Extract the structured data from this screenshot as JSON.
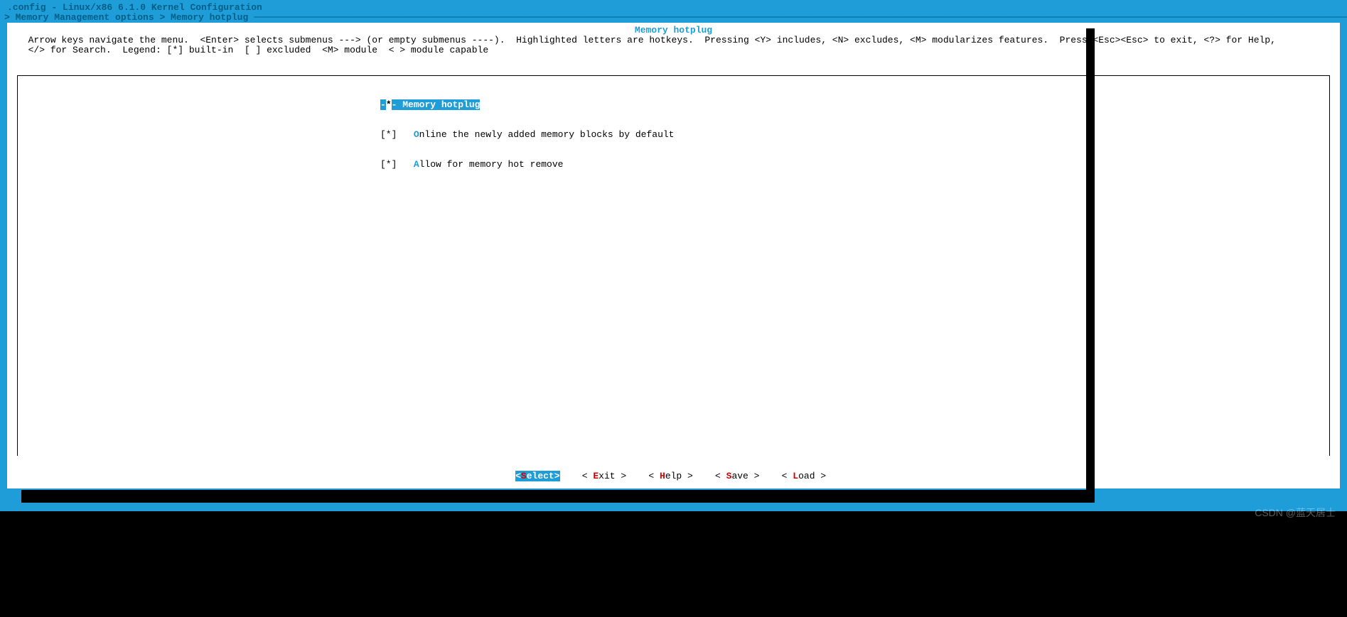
{
  "header": {
    "title": ".config - Linux/x86 6.1.0 Kernel Configuration",
    "breadcrumb_prefix": "> ",
    "breadcrumb": "Memory Management options > Memory hotplug",
    "breadcrumb_dashes": " ────────────────────────────────────────────────────────────────────────────────────────────────────────────────────────────────────────────────────────────────────────────────────────────────────────────────────────"
  },
  "main": {
    "menu_title": "Memory hotplug",
    "help_text": "  Arrow keys navigate the menu.  <Enter> selects submenus ---> (or empty submenus ----).  Highlighted letters are hotkeys.  Pressing <Y> includes, <N> excludes, <M> modularizes features.  Press <Esc><Esc> to exit, <?> for Help,\n  </> for Search.  Legend: [*] built-in  [ ] excluded  <M> module  < > module capable"
  },
  "items": [
    {
      "prefix_l": "-",
      "checkbox_star": "*",
      "prefix_r": "- ",
      "hotkey": "",
      "label": "Memory hotplug",
      "selected": true
    },
    {
      "prefix": "[*]   ",
      "hotkey": "O",
      "label": "nline the newly added memory blocks by default",
      "selected": false
    },
    {
      "prefix": "[*]   ",
      "hotkey": "A",
      "label": "llow for memory hot remove",
      "selected": false
    }
  ],
  "buttons": {
    "select": {
      "full": "<Select>",
      "pre": "<",
      "hot": "S",
      "post": "elect>"
    },
    "exit": {
      "pre": "< ",
      "hot": "E",
      "post": "xit > "
    },
    "help": {
      "pre": "< ",
      "hot": "H",
      "post": "elp > "
    },
    "save": {
      "pre": "< ",
      "hot": "S",
      "post": "ave > "
    },
    "load": {
      "pre": "< ",
      "hot": "L",
      "post": "oad > "
    }
  },
  "watermark": "CSDN @蓝天居士"
}
